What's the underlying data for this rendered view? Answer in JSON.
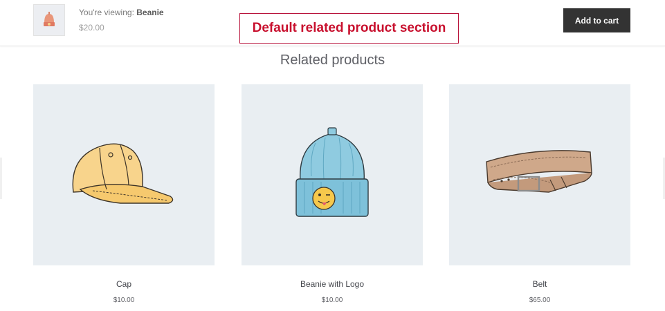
{
  "sticky_bar": {
    "viewing_prefix": "You're viewing:",
    "product_name": "Beanie",
    "price": "$20.00",
    "add_to_cart_label": "Add to cart",
    "thumbnail_icon": "beanie-thumbnail"
  },
  "annotation": {
    "label": "Default related product section"
  },
  "related": {
    "title": "Related products",
    "products": [
      {
        "name": "Cap",
        "price": "$10.00",
        "icon": "cap-image"
      },
      {
        "name": "Beanie with Logo",
        "price": "$10.00",
        "icon": "beanie-with-logo-image"
      },
      {
        "name": "Belt",
        "price": "$65.00",
        "icon": "belt-image"
      }
    ]
  },
  "colors": {
    "button_bg": "#333333",
    "annotation_red": "#c8102e",
    "card_bg": "#e9eef2"
  }
}
